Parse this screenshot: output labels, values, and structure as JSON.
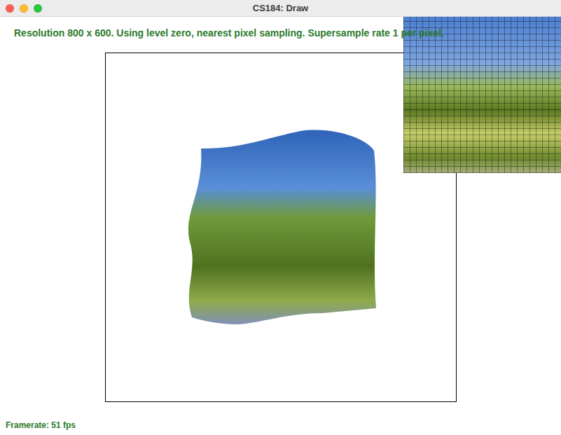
{
  "window": {
    "title": "CS184: Draw"
  },
  "status": "Resolution 800 x 600. Using level zero, nearest pixel sampling. Supersample rate 1 per pixel.",
  "framerate": "Framerate: 51 fps"
}
